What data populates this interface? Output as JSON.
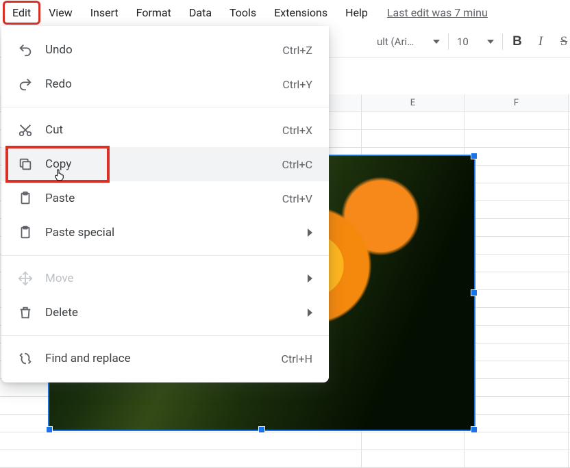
{
  "menubar": {
    "items": [
      "Edit",
      "View",
      "Insert",
      "Format",
      "Data",
      "Tools",
      "Extensions",
      "Help"
    ],
    "last_edit": "Last edit was 7 minu"
  },
  "toolbar": {
    "font_label": "ult (Ari…",
    "font_size": "10"
  },
  "columns": [
    "E",
    "F"
  ],
  "dropdown": {
    "undo": {
      "label": "Undo",
      "shortcut": "Ctrl+Z"
    },
    "redo": {
      "label": "Redo",
      "shortcut": "Ctrl+Y"
    },
    "cut": {
      "label": "Cut",
      "shortcut": "Ctrl+X"
    },
    "copy": {
      "label": "Copy",
      "shortcut": "Ctrl+C"
    },
    "paste": {
      "label": "Paste",
      "shortcut": "Ctrl+V"
    },
    "paste_special": {
      "label": "Paste special"
    },
    "move": {
      "label": "Move"
    },
    "delete": {
      "label": "Delete"
    },
    "find_replace": {
      "label": "Find and replace",
      "shortcut": "Ctrl+H"
    }
  }
}
